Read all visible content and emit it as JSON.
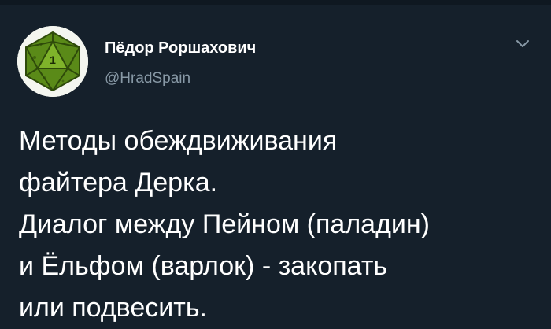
{
  "author": {
    "name": "Пёдор Роршахович",
    "handle": "@HradSpain",
    "avatar_icon": "d20-dice-icon",
    "avatar_die_number": "1"
  },
  "menu": {
    "icon": "chevron-down-icon"
  },
  "tweet": {
    "lines": [
      "Методы обеждвиживания",
      "файтера Дерка.",
      "Диалог между Пейном (паладин)",
      "и Ёльфом (варлок) - закопать",
      "или подвесить."
    ]
  },
  "colors": {
    "background": "#15202b",
    "text": "#ffffff",
    "secondary_text": "#8899a6",
    "avatar_green": "#5a8a18"
  }
}
